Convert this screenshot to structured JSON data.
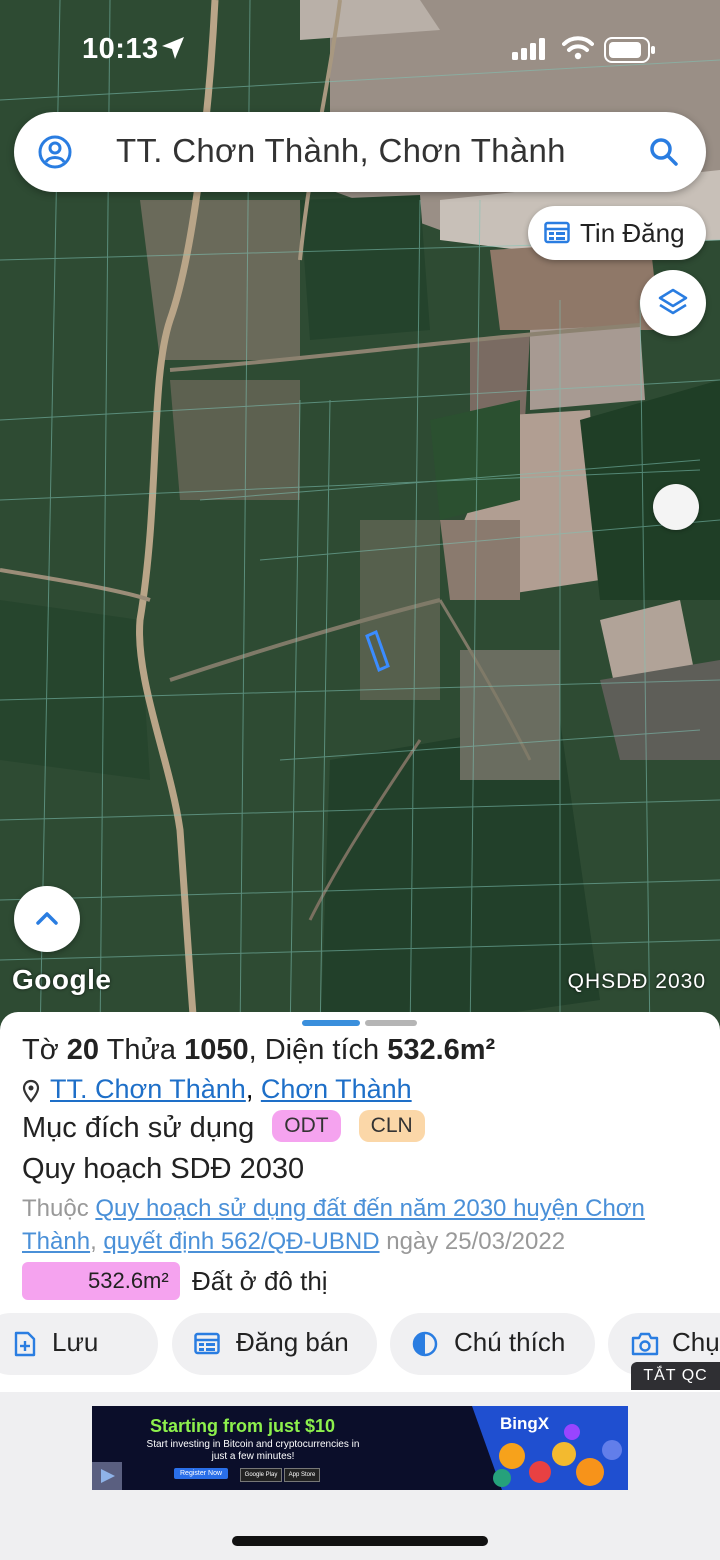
{
  "status_bar": {
    "time": "10:13"
  },
  "search": {
    "text": "TT. Chơn Thành, Chơn Thành"
  },
  "map": {
    "post_button_label": "Tin Đăng",
    "attribution": "Google",
    "layer_name": "QHSDĐ 2030"
  },
  "parcel": {
    "title_prefix": "Tờ",
    "sheet_no": "20",
    "parcel_label": "Thửa",
    "parcel_no": "1050",
    "area_label": ", Diện tích",
    "area": "532.6m²",
    "ward_link": "TT. Chơn Thành",
    "address_sep": ",",
    "district_link": "Chơn Thành",
    "purpose_label": "Mục đích sử dụng",
    "tags": [
      "ODT",
      "CLN"
    ],
    "plan_title": "Quy hoạch SDĐ 2030",
    "source_prefix": "Thuộc",
    "source_link": "Quy hoạch sử dụng đất đến năm 2030 huyện Chơn Thành",
    "source_sep": ",",
    "decision_link": "quyết định 562/QĐ-UBND",
    "date_text": "ngày 25/03/2022",
    "breakdown": [
      {
        "area": "532.6m²",
        "label": "Đất ở đô thị",
        "color": "#f5a3ef"
      }
    ]
  },
  "actions": {
    "save": "Lưu",
    "sell": "Đăng bán",
    "legend": "Chú thích",
    "capture": "Chụ"
  },
  "ad": {
    "close_label": "TẮT QC",
    "headline": "Starting from just $10",
    "subtext": "Start investing in Bitcoin and cryptocurrencies in just a few minutes!",
    "brand": "BingX",
    "cta": "Register Now",
    "store_google": "Google Play",
    "store_apple": "App Store"
  },
  "colors": {
    "link": "#1e6fc8",
    "odt_tag": "#f5a3ef",
    "cln_tag": "#fbd7a8",
    "ad_headline": "#8df04c"
  }
}
